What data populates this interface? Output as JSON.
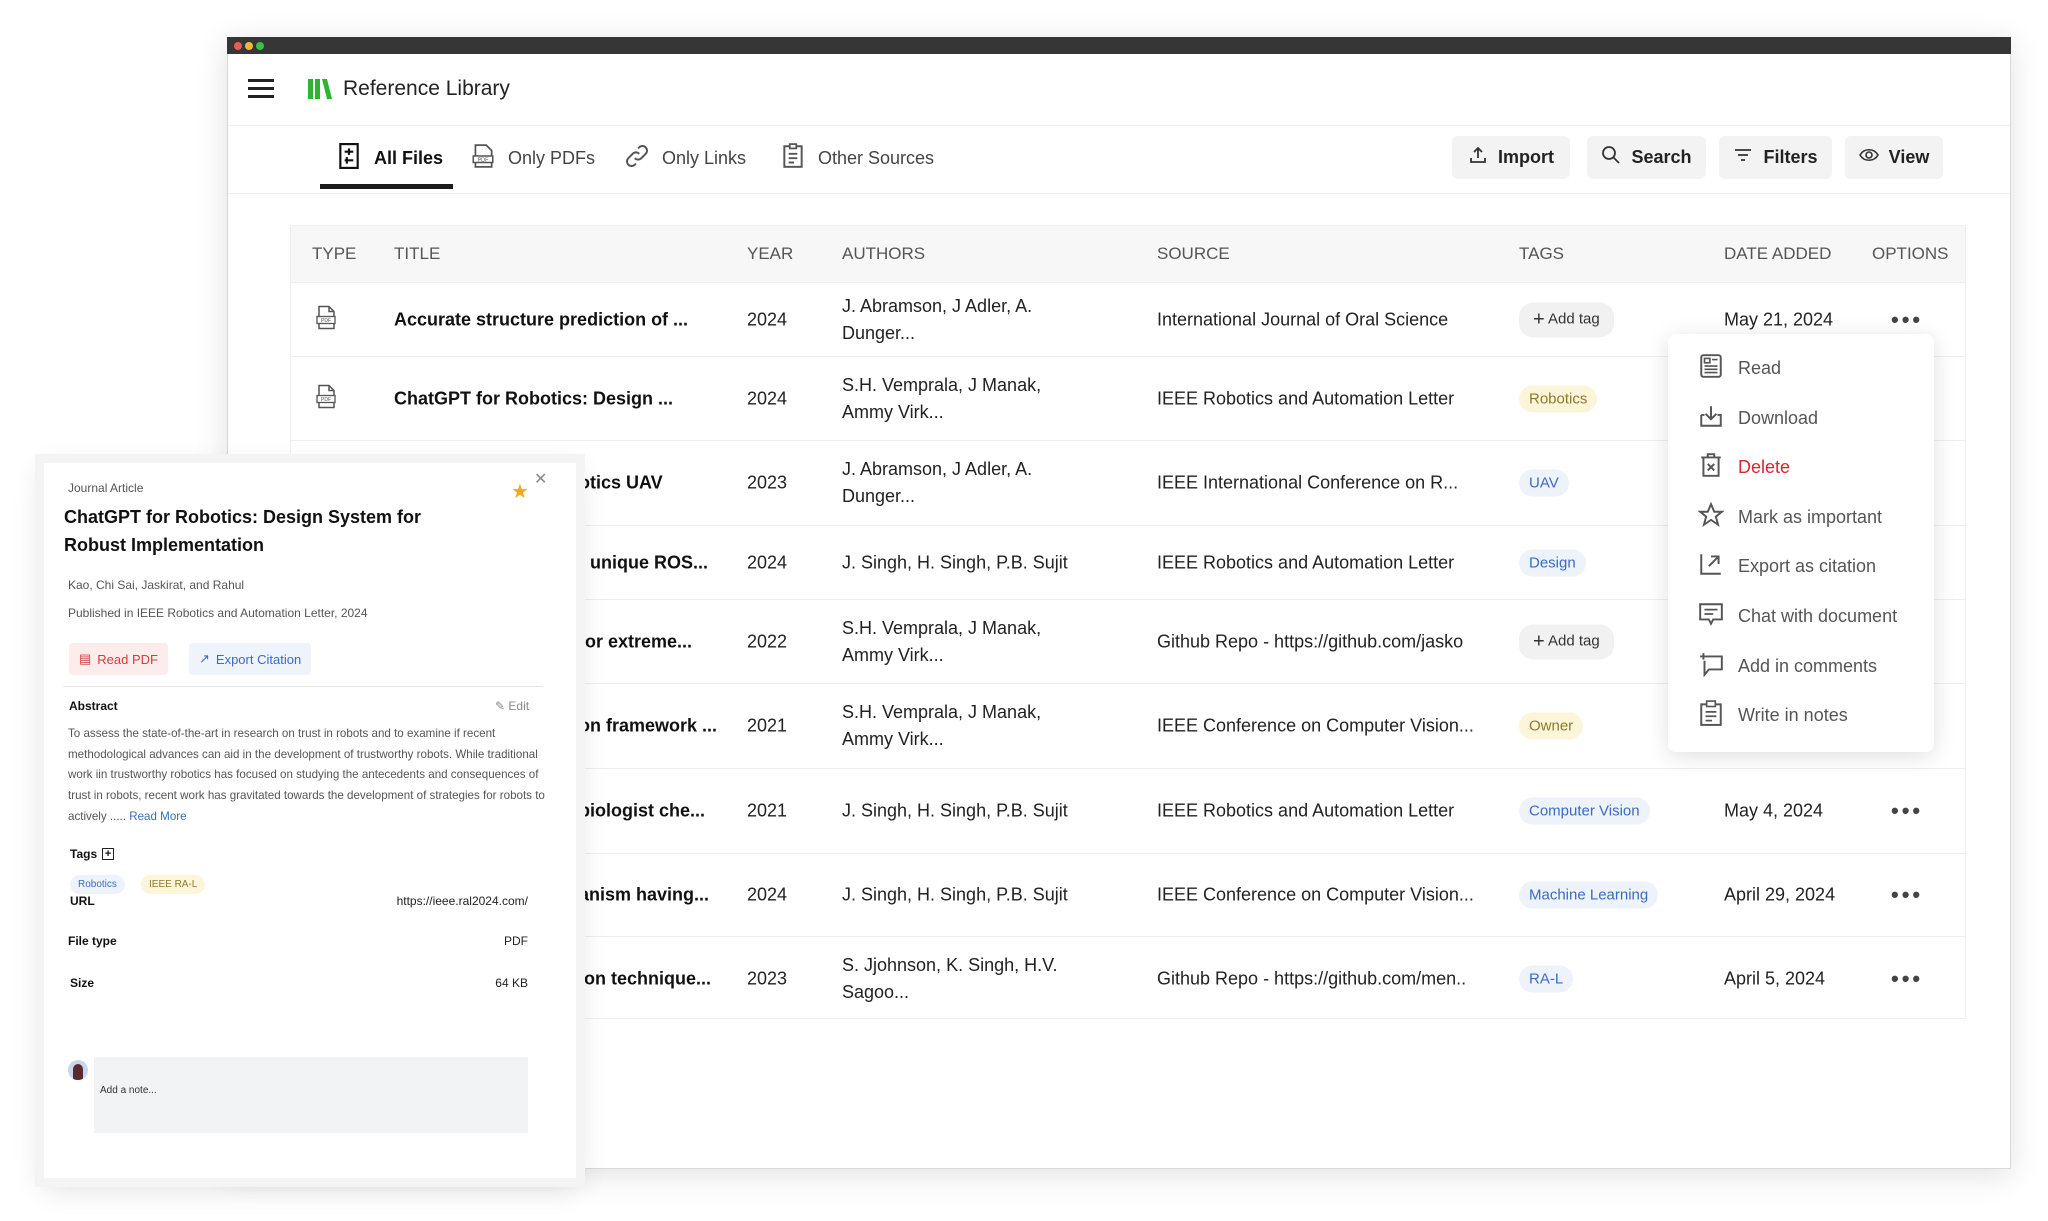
{
  "app": {
    "title": "Reference Library",
    "brand_color": "#2db52d"
  },
  "tabs": [
    {
      "label": "All Files",
      "icon": "sliders-icon",
      "active": true
    },
    {
      "label": "Only PDFs",
      "icon": "pdf-icon"
    },
    {
      "label": "Only Links",
      "icon": "link-icon"
    },
    {
      "label": "Other Sources",
      "icon": "clipboard-icon"
    }
  ],
  "toolbar": {
    "import": "Import",
    "search": "Search",
    "filters": "Filters",
    "view": "View"
  },
  "table": {
    "headers": [
      "TYPE",
      "TITLE",
      "YEAR",
      "AUTHORS",
      "SOURCE",
      "TAGS",
      "DATE ADDED",
      "OPTIONS"
    ],
    "rows": [
      {
        "type": "pdf",
        "title": "Accurate structure prediction of ...",
        "year": "2024",
        "authors": "J. Abramson, J Adler, A. Dunger...",
        "source": "International Journal of Oral Science",
        "tag": "Add tag",
        "tag_style": "add",
        "date": "May 21, 2024",
        "options": "•••"
      },
      {
        "type": "pdf",
        "title": "ChatGPT for Robotics: Design ...",
        "year": "2024",
        "authors": "S.H. Vemprala, J Manak, Ammy Virk...",
        "source": "IEEE Robotics and Automation Letter",
        "tag": "Robotics",
        "tag_style": "yellow"
      },
      {
        "title": "otics UAV",
        "year": "2023",
        "authors": "J. Abramson, J Adler, A. Dunger...",
        "source": "IEEE International Conference on R...",
        "tag": "UAV",
        "tag_style": "blue"
      },
      {
        "title": "t unique ROS...",
        "year": "2024",
        "authors": "J. Singh, H. Singh, P.B. Sujit",
        "source": "IEEE Robotics and Automation Letter",
        "tag": "Design",
        "tag_style": "blue"
      },
      {
        "title": "for extreme...",
        "year": "2022",
        "authors": "S.H. Vemprala, J Manak, Ammy Virk...",
        "source": "Github Repo - https://github.com/jasko",
        "tag": "Add tag",
        "tag_style": "add"
      },
      {
        "title": "on framework ...",
        "year": "2021",
        "authors": "S.H. Vemprala, J Manak, Ammy Virk...",
        "source": "IEEE Conference on Computer Vision...",
        "tag": "Owner",
        "tag_style": "yellow"
      },
      {
        "title": "biologist che...",
        "year": "2021",
        "authors": "J. Singh, H. Singh, P.B. Sujit",
        "source": "IEEE Robotics and Automation Letter",
        "tag": "Computer Vision",
        "tag_style": "blue",
        "date": "May 4, 2024",
        "options": "•••"
      },
      {
        "title": "anism having...",
        "year": "2024",
        "authors": "J. Singh, H. Singh, P.B. Sujit",
        "source": "IEEE Conference on Computer Vision...",
        "tag": "Machine Learning",
        "tag_style": "blue",
        "date": "April 29, 2024",
        "options": "•••"
      },
      {
        "title": "ion technique...",
        "year": "2023",
        "authors": "S. Jjohnson, K. Singh, H.V. Sagoo...",
        "source": "Github Repo - https://github.com/men..",
        "tag": "RA-L",
        "tag_style": "blue",
        "date": "April 5, 2024",
        "options": "•••"
      }
    ]
  },
  "menu": {
    "items": [
      {
        "label": "Read",
        "icon": "read-icon"
      },
      {
        "label": "Download",
        "icon": "download-icon"
      },
      {
        "label": "Delete",
        "icon": "trash-icon",
        "danger": true
      },
      {
        "label": "Mark as important",
        "icon": "star-icon"
      },
      {
        "label": "Export as citation",
        "icon": "export-icon"
      },
      {
        "label": "Chat with document",
        "icon": "chat-icon"
      },
      {
        "label": "Add in comments",
        "icon": "comment-add-icon"
      },
      {
        "label": "Write in notes",
        "icon": "notes-icon"
      }
    ]
  },
  "panel": {
    "kind": "Journal Article",
    "title": "ChatGPT for Robotics: Design System for Robust Implementation",
    "authors": "Kao, Chi  Sai, Jaskirat, and  Rahul",
    "published": "Published in  IEEE Robotics and Automation Letter, 2024",
    "read_pdf": "Read PDF",
    "export_citation": "Export Citation",
    "abstract_label": "Abstract",
    "edit": "Edit",
    "abstract": "To assess the state-of-the-art in research on trust in robots  and to examine if recent methodological advances can aid in  the development of trustworthy robots. While traditional work iin trustworthy robotics has focused on studying the  antecedents and consequences of trust in robots, recent work has gravitated towards the development of strategies for  robots to actively .....",
    "read_more": "Read More",
    "tags_label": "Tags",
    "tags": [
      "Robotics",
      "IEEE RA-L"
    ],
    "url_label": "URL",
    "url": "https://ieee.ral2024.com/",
    "filetype_label": "File type",
    "filetype": "PDF",
    "size_label": "Size",
    "size": "64 KB",
    "note_placeholder": "Add a note...",
    "starred": true
  }
}
